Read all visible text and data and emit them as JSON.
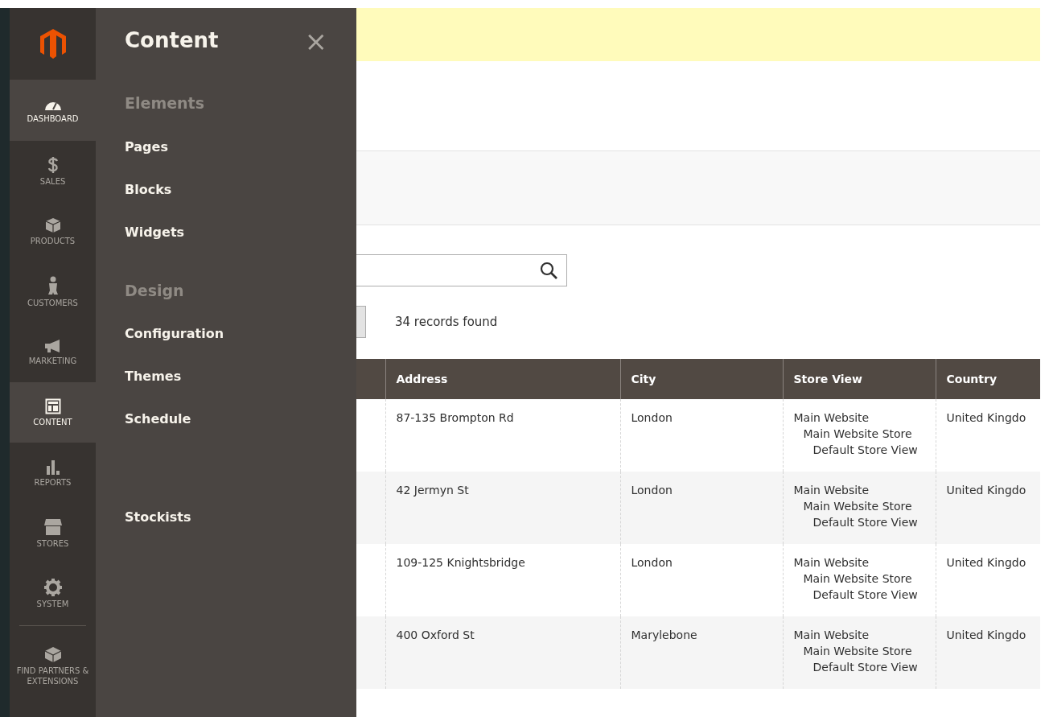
{
  "sidebar": {
    "items": [
      {
        "kind": "dashboard",
        "label": "DASHBOARD",
        "highlighted": true
      },
      {
        "kind": "sales",
        "label": "SALES",
        "highlighted": false
      },
      {
        "kind": "products",
        "label": "PRODUCTS",
        "highlighted": false
      },
      {
        "kind": "customers",
        "label": "CUSTOMERS",
        "highlighted": false
      },
      {
        "kind": "marketing",
        "label": "MARKETING",
        "highlighted": false
      },
      {
        "kind": "content",
        "label": "CONTENT",
        "highlighted": true
      },
      {
        "kind": "reports",
        "label": "REPORTS",
        "highlighted": false
      },
      {
        "kind": "stores",
        "label": "STORES",
        "highlighted": false
      },
      {
        "kind": "system",
        "label": "SYSTEM",
        "highlighted": false
      },
      {
        "kind": "partners",
        "label": "FIND PARTNERS & EXTENSIONS",
        "highlighted": false
      }
    ]
  },
  "flyout": {
    "title": "Content",
    "close": "×",
    "sections": [
      {
        "heading": "Elements",
        "items": [
          "Pages",
          "Blocks",
          "Widgets"
        ]
      },
      {
        "heading": "Design",
        "items": [
          "Configuration",
          "Themes",
          "Schedule"
        ]
      },
      {
        "items": [
          "Stockists"
        ]
      }
    ]
  },
  "grid": {
    "records": "34 records found",
    "columns": [
      "Address",
      "City",
      "Store View",
      "Country"
    ],
    "rows": [
      {
        "address": "87-135 Brompton Rd",
        "city": "London",
        "store_view": [
          "Main Website",
          "Main Website Store",
          "Default Store View"
        ],
        "country": "United Kingdo"
      },
      {
        "address": "42 Jermyn St",
        "city": "London",
        "store_view": [
          "Main Website",
          "Main Website Store",
          "Default Store View"
        ],
        "country": "United Kingdo"
      },
      {
        "address": "109-125 Knightsbridge",
        "city": "London",
        "store_view": [
          "Main Website",
          "Main Website Store",
          "Default Store View"
        ],
        "country": "United Kingdo"
      },
      {
        "address": "400 Oxford St",
        "city": "Marylebone",
        "store_view": [
          "Main Website",
          "Main Website Store",
          "Default Store View"
        ],
        "country": "United Kingdo"
      }
    ]
  }
}
